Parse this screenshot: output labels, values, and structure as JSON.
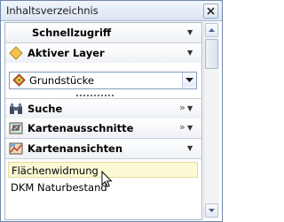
{
  "window": {
    "title": "Inhaltsverzeichnis",
    "close_icon": "close-icon"
  },
  "sections": [
    {
      "id": "schnellzugriff",
      "label": "Schnellzugriff",
      "icon": null,
      "indicator": "dropdown-arrow"
    },
    {
      "id": "aktiver-layer",
      "label": "Aktiver Layer",
      "icon": "diamond-layer-icon",
      "indicator": "dropdown-arrow"
    },
    {
      "id": "suche",
      "label": "Suche",
      "icon": "binoculars-icon",
      "indicator": "double-chevron-and-arrow"
    },
    {
      "id": "kartenausschnitte",
      "label": "Kartenausschnitte",
      "icon": "map-extent-icon",
      "indicator": "double-chevron-and-arrow"
    },
    {
      "id": "kartenansichten",
      "label": "Kartenansichten",
      "icon": "map-view-icon",
      "indicator": "dropdown-arrow"
    }
  ],
  "layer_combo": {
    "value": "Grundstücke",
    "icon": "layer-diamond-icon"
  },
  "map_views": [
    {
      "label": "Flächenwidmung",
      "selected": true
    },
    {
      "label": "DKM Naturbestand",
      "selected": false
    }
  ],
  "colors": {
    "frame_border": "#6f87a8",
    "selected_item_bg": "#fbf8d4",
    "aktiver_layer_icon": "#f2c34d"
  }
}
